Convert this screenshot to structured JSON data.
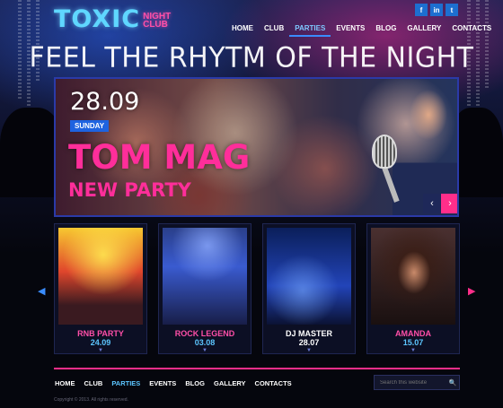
{
  "brand": {
    "main": "TOXIC",
    "sub_line1": "NIGHT",
    "sub_line2": "CLUB"
  },
  "social": [
    {
      "icon": "facebook-icon",
      "glyph": "f"
    },
    {
      "icon": "linkedin-icon",
      "glyph": "in"
    },
    {
      "icon": "twitter-icon",
      "glyph": "t"
    }
  ],
  "nav": [
    "HOME",
    "CLUB",
    "PARTIES",
    "EVENTS",
    "BLOG",
    "GALLERY",
    "CONTACTS"
  ],
  "nav_active": "PARTIES",
  "tagline": "FEEL THE RHYTM OF THE NIGHT",
  "hero": {
    "date": "28.09",
    "day": "SUNDAY",
    "title": "TOM MAG",
    "subtitle": "NEW PARTY",
    "prev": "‹",
    "next": "›"
  },
  "cards": [
    {
      "name": "RNB PARTY",
      "date": "24.09",
      "caret": "▼"
    },
    {
      "name": "ROCK LEGEND",
      "date": "03.08",
      "caret": "▼"
    },
    {
      "name": "DJ MASTER",
      "date": "28.07",
      "caret": "▼"
    },
    {
      "name": "AMANDA",
      "date": "15.07",
      "caret": "▼"
    }
  ],
  "carousel": {
    "left": "◀",
    "right": "▶"
  },
  "footer": {
    "nav": [
      "HOME",
      "CLUB",
      "PARTIES",
      "EVENTS",
      "BLOG",
      "GALLERY",
      "CONTACTS"
    ],
    "search_placeholder": "Search this website",
    "search_icon": "🔍",
    "copyright": "Copyright © 2013. All rights reserved."
  },
  "colors": {
    "accent_pink": "#ff2e8a",
    "accent_blue": "#3a8cff",
    "logo_cyan": "#5fd7ff"
  }
}
